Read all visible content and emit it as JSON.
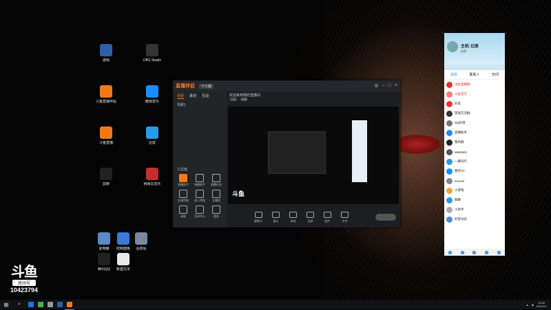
{
  "desktop": {
    "icons": [
      {
        "label": "游戏",
        "color": "#2b5fa8"
      },
      {
        "label": "斗鱼直播伴侣",
        "color": "#f07a1a"
      },
      {
        "label": "斗鱼直播",
        "color": "#f07a1a"
      },
      {
        "label": "剪映",
        "color": "#222222"
      },
      {
        "label": "OBS Studio",
        "color": "#333333"
      },
      {
        "label": "酷狗音乐",
        "color": "#1a8cff"
      },
      {
        "label": "迅雷",
        "color": "#2a9ae8"
      },
      {
        "label": "网易云音乐",
        "color": "#c62f2f"
      },
      {
        "label": "此电脑",
        "color": "#5a8ac8"
      },
      {
        "label": "控制面板",
        "color": "#3a7ad8"
      },
      {
        "label": "回收站",
        "color": "#7a8a9a"
      },
      {
        "label": "腾讯QQ",
        "color": "#222222"
      },
      {
        "label": "新建文本",
        "color": "#e8e8e8"
      }
    ]
  },
  "watermark": {
    "logo": "斗鱼",
    "room_label": "房间号",
    "room_number": "10423794"
  },
  "streaming_app": {
    "logo": "直播伴侣",
    "badge": "个人版",
    "left_tabs": [
      "场景",
      "素材",
      "互动"
    ],
    "scene_item": "场景1",
    "tools_title": "工具箱",
    "tools": [
      "直播助手",
      "弹幕助手",
      "直播任务",
      "礼物特效",
      "进入特效",
      "主播榜",
      "录屏",
      "活动中心",
      "更多"
    ],
    "stream_title": "欢迎来到我的直播间",
    "tags": [
      "分区",
      "标签"
    ],
    "preview_logo": "斗鱼",
    "controls": [
      "摄像头",
      "窗口",
      "游戏",
      "全屏",
      "图片",
      "文字"
    ],
    "live_label": "开始直播"
  },
  "chat_panel": {
    "name": "主机·记录",
    "subtitle": "在线",
    "tabs": [
      "消息",
      "联系人",
      "空间"
    ],
    "rows": [
      {
        "name": "主机直播群",
        "red": true,
        "avatar": "#d33"
      },
      {
        "name": "斗鱼官方",
        "red": true,
        "avatar": "#f77"
      },
      {
        "name": "好友",
        "red": false,
        "avatar": "#e33"
      },
      {
        "name": "游戏交流群",
        "red": false,
        "avatar": "#334"
      },
      {
        "name": "QQ好友",
        "red": false,
        "avatar": "#777"
      },
      {
        "name": "直播助手",
        "red": false,
        "avatar": "#1a8cff"
      },
      {
        "name": "我的群",
        "red": false,
        "avatar": "#222"
      },
      {
        "name": "MeliMelo",
        "red": false,
        "avatar": "#556"
      },
      {
        "name": "一路同行",
        "red": false,
        "avatar": "#2a9ae8"
      },
      {
        "name": "我的TV",
        "red": false,
        "avatar": "#1a8cff"
      },
      {
        "name": "Kuromi",
        "red": false,
        "avatar": "#888"
      },
      {
        "name": "小游戏",
        "red": false,
        "avatar": "#e8a33a"
      },
      {
        "name": "群聊",
        "red": false,
        "avatar": "#2a9ae8"
      },
      {
        "name": "小助手",
        "red": false,
        "avatar": "#aaa"
      },
      {
        "name": "好友动态",
        "red": false,
        "avatar": "#4a8ad8"
      }
    ]
  },
  "taskbar": {
    "search_icon": "search-icon",
    "apps": [
      {
        "color": "#1a73e8",
        "active": false
      },
      {
        "color": "#4caf50",
        "active": false
      },
      {
        "color": "#999999",
        "active": false
      },
      {
        "color": "#2b5fa8",
        "active": false
      },
      {
        "color": "#f07a1a",
        "active": true
      }
    ],
    "time": "16:32",
    "date": "2022/2/7"
  }
}
